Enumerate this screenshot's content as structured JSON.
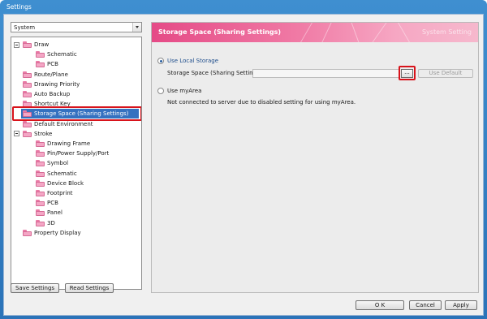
{
  "window": {
    "title": "Settings"
  },
  "category_select": {
    "value": "System"
  },
  "tree": [
    {
      "label": "Draw",
      "level": 0,
      "expander": true
    },
    {
      "label": "Schematic",
      "level": 1
    },
    {
      "label": "PCB",
      "level": 1
    },
    {
      "label": "Route/Plane",
      "level": 0
    },
    {
      "label": "Drawing Priority",
      "level": 0
    },
    {
      "label": "Auto Backup",
      "level": 0
    },
    {
      "label": "Shortcut Key",
      "level": 0
    },
    {
      "label": "Storage Space (Sharing Settings)",
      "level": 0,
      "selected": true
    },
    {
      "label": "Default Environment",
      "level": 0
    },
    {
      "label": "Stroke",
      "level": 0,
      "expander": true
    },
    {
      "label": "Drawing Frame",
      "level": 1
    },
    {
      "label": "Pin/Power Supply/Port",
      "level": 1
    },
    {
      "label": "Symbol",
      "level": 1
    },
    {
      "label": "Schematic",
      "level": 1
    },
    {
      "label": "Device Block",
      "level": 1
    },
    {
      "label": "Footprint",
      "level": 1
    },
    {
      "label": "PCB",
      "level": 1
    },
    {
      "label": "Panel",
      "level": 1
    },
    {
      "label": "3D",
      "level": 1
    },
    {
      "label": "Property Display",
      "level": 0
    }
  ],
  "left_buttons": {
    "save": "Save Settings",
    "read": "Read Settings"
  },
  "panel": {
    "title": "Storage Space (Sharing Settings)",
    "subtitle": "System Setting",
    "local_storage_label": "Use Local Storage",
    "storage_space_label": "Storage Space (Sharing Settings)",
    "storage_space_value": "",
    "browse_label": "...",
    "use_default_label": "Use Default",
    "myarea_label": "Use myArea",
    "myarea_note": "Not connected to server due to disabled setting for using myArea."
  },
  "footer": {
    "ok": "O K",
    "cancel": "Cancel",
    "apply": "Apply"
  },
  "colors": {
    "accent_pink": "#e54a86",
    "selection_blue": "#3471c0",
    "highlight_red": "#d8131b"
  }
}
